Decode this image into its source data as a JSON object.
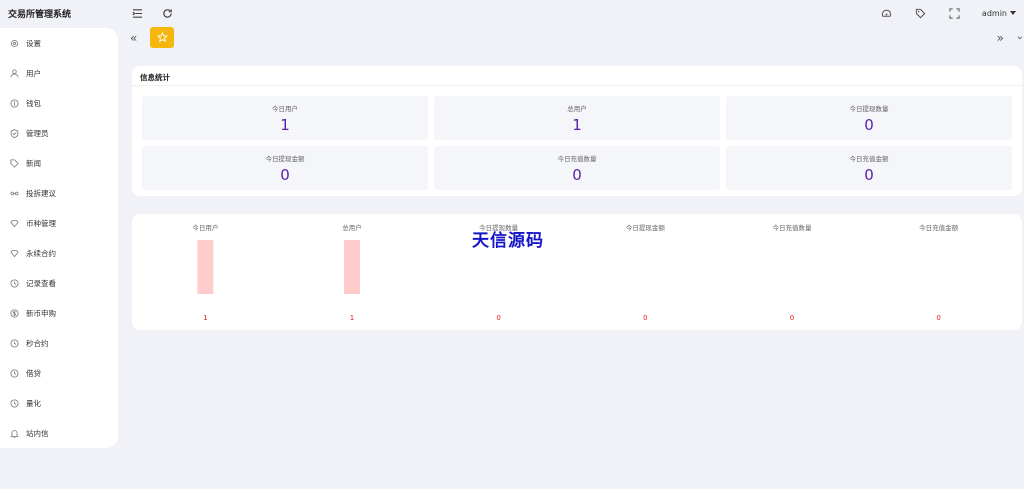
{
  "app": {
    "title": "交易所管理系统"
  },
  "header": {
    "user": "admin"
  },
  "sidebar": {
    "items": [
      {
        "label": "设置",
        "icon": "gear-icon"
      },
      {
        "label": "用户",
        "icon": "user-icon"
      },
      {
        "label": "钱包",
        "icon": "wallet-icon"
      },
      {
        "label": "管理员",
        "icon": "shield-icon"
      },
      {
        "label": "新闻",
        "icon": "tag-icon"
      },
      {
        "label": "投拆建议",
        "icon": "link-icon"
      },
      {
        "label": "币种管理",
        "icon": "diamond-icon"
      },
      {
        "label": "永续合约",
        "icon": "diamond-icon"
      },
      {
        "label": "记录查看",
        "icon": "clock-icon"
      },
      {
        "label": "新币申购",
        "icon": "dollar-icon"
      },
      {
        "label": "秒合约",
        "icon": "clock-icon"
      },
      {
        "label": "借贷",
        "icon": "clock-icon"
      },
      {
        "label": "量化",
        "icon": "clock-icon"
      },
      {
        "label": "站内信",
        "icon": "bell-icon"
      }
    ]
  },
  "stats": {
    "title": "信息统计",
    "items": [
      {
        "label": "今日用户",
        "value": "1"
      },
      {
        "label": "总用户",
        "value": "1"
      },
      {
        "label": "今日提现数量",
        "value": "0"
      },
      {
        "label": "今日提现金额",
        "value": "0"
      },
      {
        "label": "今日充值数量",
        "value": "0"
      },
      {
        "label": "今日充值金额",
        "value": "0"
      }
    ]
  },
  "watermark": "天信源码",
  "chart_data": {
    "type": "bar",
    "categories": [
      "今日用户",
      "总用户",
      "今日提现数量",
      "今日提现金额",
      "今日充值数量",
      "今日充值金额"
    ],
    "values": [
      1,
      1,
      0,
      0,
      0,
      0
    ],
    "ylim": [
      0,
      1
    ],
    "bar_color": "#ffcccc",
    "label_color": "#e02020"
  }
}
